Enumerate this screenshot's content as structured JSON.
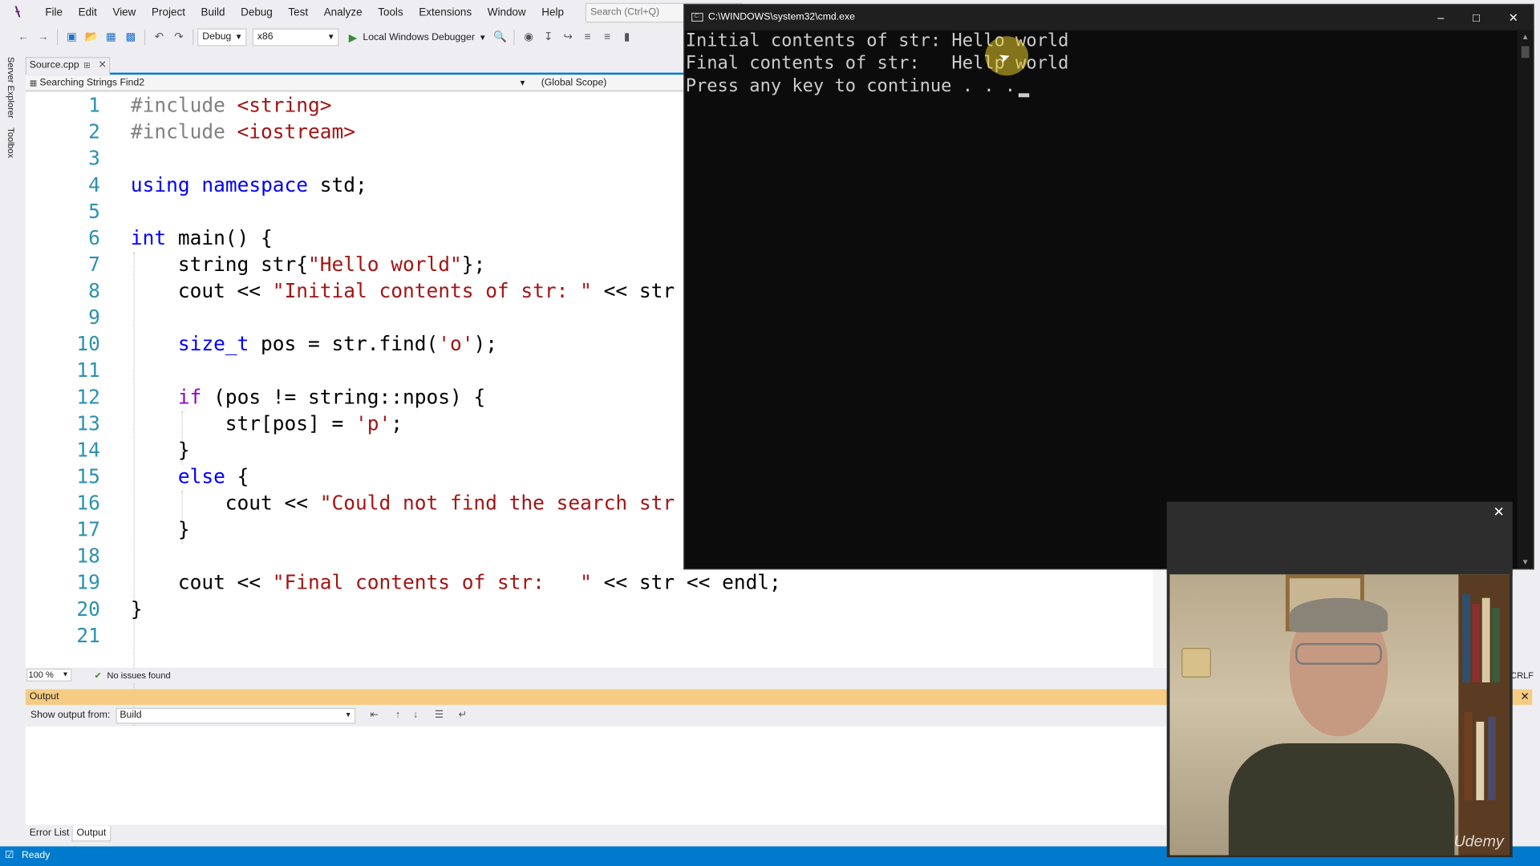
{
  "menu": {
    "items": [
      "File",
      "Edit",
      "View",
      "Project",
      "Build",
      "Debug",
      "Test",
      "Analyze",
      "Tools",
      "Extensions",
      "Window",
      "Help"
    ],
    "search_placeholder": "Search (Ctrl+Q)"
  },
  "toolbar": {
    "configuration": "Debug",
    "platform": "x86",
    "debugger_label": "Local Windows Debugger"
  },
  "sidebar": {
    "server_explorer": "Server Explorer",
    "toolbox": "Toolbox"
  },
  "editor": {
    "tab_label": "Source.cpp",
    "nav_project": "Searching Strings Find2",
    "nav_scope": "(Global Scope)",
    "lines": [
      {
        "n": "1",
        "code": "#include <string>"
      },
      {
        "n": "2",
        "code": "#include <iostream>"
      },
      {
        "n": "3",
        "code": ""
      },
      {
        "n": "4",
        "code": "using namespace std;"
      },
      {
        "n": "5",
        "code": ""
      },
      {
        "n": "6",
        "code": "int main() {"
      },
      {
        "n": "7",
        "code": "    string str{\"Hello world\"};"
      },
      {
        "n": "8",
        "code": "    cout << \"Initial contents of str: \" << str"
      },
      {
        "n": "9",
        "code": ""
      },
      {
        "n": "10",
        "code": "    size_t pos = str.find('o');"
      },
      {
        "n": "11",
        "code": ""
      },
      {
        "n": "12",
        "code": "    if (pos != string::npos) {"
      },
      {
        "n": "13",
        "code": "        str[pos] = 'p';"
      },
      {
        "n": "14",
        "code": "    }"
      },
      {
        "n": "15",
        "code": "    else {"
      },
      {
        "n": "16",
        "code": "        cout << \"Could not find the search str"
      },
      {
        "n": "17",
        "code": "    }"
      },
      {
        "n": "18",
        "code": ""
      },
      {
        "n": "19",
        "code": "    cout << \"Final contents of str:   \" << str << endl;"
      },
      {
        "n": "20",
        "code": "}"
      },
      {
        "n": "21",
        "code": ""
      }
    ],
    "zoom": "100 %",
    "issues": "No issues found",
    "line_ending": "CRLF"
  },
  "output": {
    "title": "Output",
    "show_from_label": "Show output from:",
    "source": "Build"
  },
  "bottom_tabs": [
    "Error List",
    "Output"
  ],
  "status": {
    "text": "Ready"
  },
  "console": {
    "title": "C:\\WINDOWS\\system32\\cmd.exe",
    "lines": [
      "Initial contents of str: Hello world",
      "Final contents of str:   Hellp world",
      "Press any key to continue . . . "
    ]
  },
  "webcam": {
    "watermark": "Udemy"
  }
}
